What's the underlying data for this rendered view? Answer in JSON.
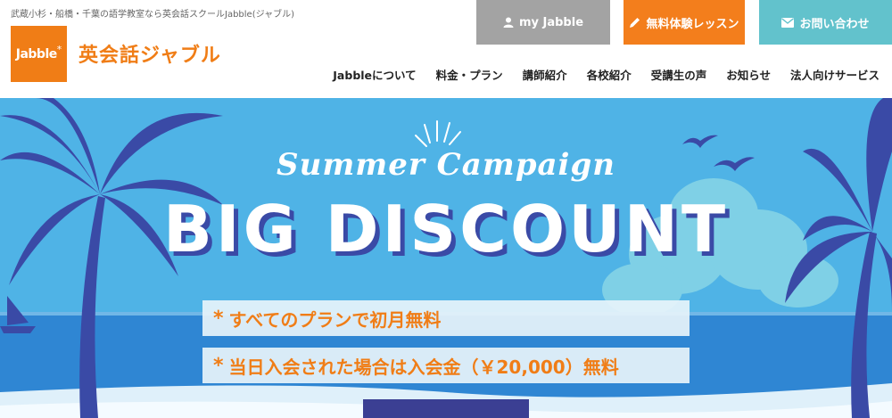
{
  "header": {
    "tagline": "武蔵小杉・船橋・千葉の語学教室なら英会話スクールJabble(ジャブル)",
    "logo_text": "Jabble",
    "logo_star": "*",
    "brand_name": "英会話ジャブル",
    "buttons": {
      "myjabble": {
        "label": "my Jabble",
        "icon": "person-icon"
      },
      "trial": {
        "label": "無料体験レッスン",
        "icon": "pencil-icon"
      },
      "contact": {
        "label": "お問い合わせ",
        "icon": "envelope-icon"
      }
    },
    "nav": [
      {
        "label": "Jabbleについて"
      },
      {
        "label": "料金・プラン"
      },
      {
        "label": "講師紹介"
      },
      {
        "label": "各校紹介"
      },
      {
        "label": "受講生の声"
      },
      {
        "label": "お知らせ"
      },
      {
        "label": "法人向けサービス"
      }
    ]
  },
  "hero": {
    "subtitle": "Summer Campaign",
    "title": "BIG DISCOUNT",
    "bullets": [
      {
        "star": "*",
        "text": "すべてのプランで初月無料"
      },
      {
        "star": "*",
        "text": "当日入会された場合は入会金（￥20,000）無料"
      }
    ]
  },
  "colors": {
    "brand_orange": "#f07d16",
    "sky": "#52b6e8",
    "sea": "#3a8fd6",
    "navy": "#3a4aa6",
    "gray_button": "#a3a3a3",
    "teal_button": "#62c2cc"
  }
}
